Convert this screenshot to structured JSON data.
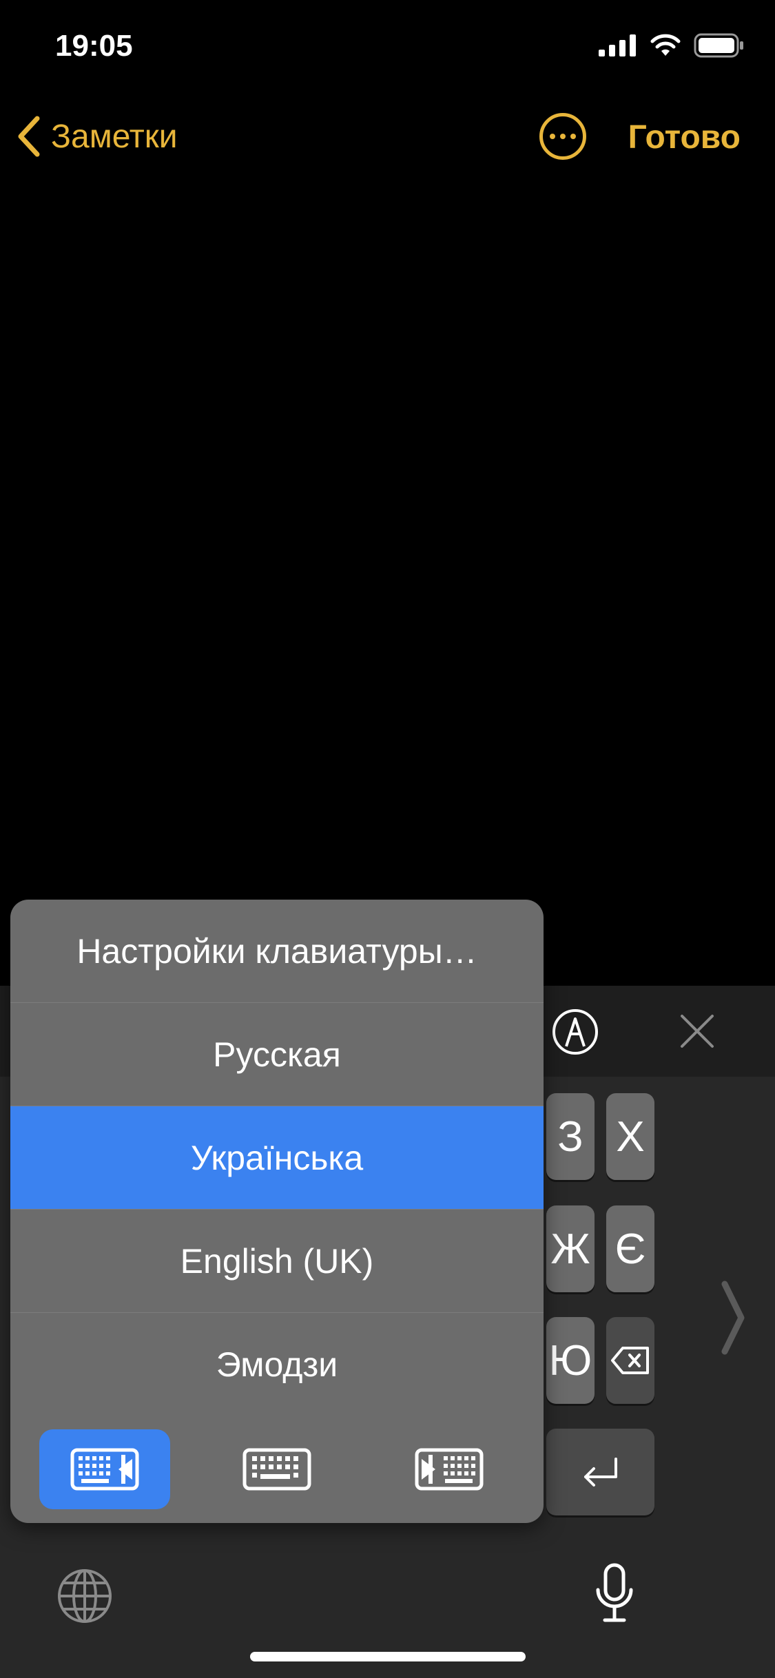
{
  "status_bar": {
    "time": "19:05"
  },
  "nav": {
    "back_label": "Заметки",
    "done_label": "Готово"
  },
  "popup": {
    "items": [
      {
        "label": "Настройки клавиатуры…",
        "selected": false
      },
      {
        "label": "Русская",
        "selected": false
      },
      {
        "label": "Українська",
        "selected": true
      },
      {
        "label": "English (UK)",
        "selected": false
      },
      {
        "label": "Эмодзи",
        "selected": false
      }
    ],
    "keyboard_modes": [
      {
        "icon": "keyboard-left-icon",
        "active": true
      },
      {
        "icon": "keyboard-full-icon",
        "active": false
      },
      {
        "icon": "keyboard-right-icon",
        "active": false
      }
    ]
  },
  "keyboard": {
    "row1": [
      "З",
      "Х"
    ],
    "row2": [
      "Ж",
      "Є"
    ],
    "row3": [
      "Ю"
    ],
    "icons": [
      "markup-icon",
      "close-icon",
      "chevron-right-icon",
      "backspace-icon",
      "return-icon",
      "globe-icon",
      "microphone-icon"
    ]
  },
  "colors": {
    "accent": "#E8B53A",
    "selection": "#3B82F0",
    "background": "#000000"
  }
}
